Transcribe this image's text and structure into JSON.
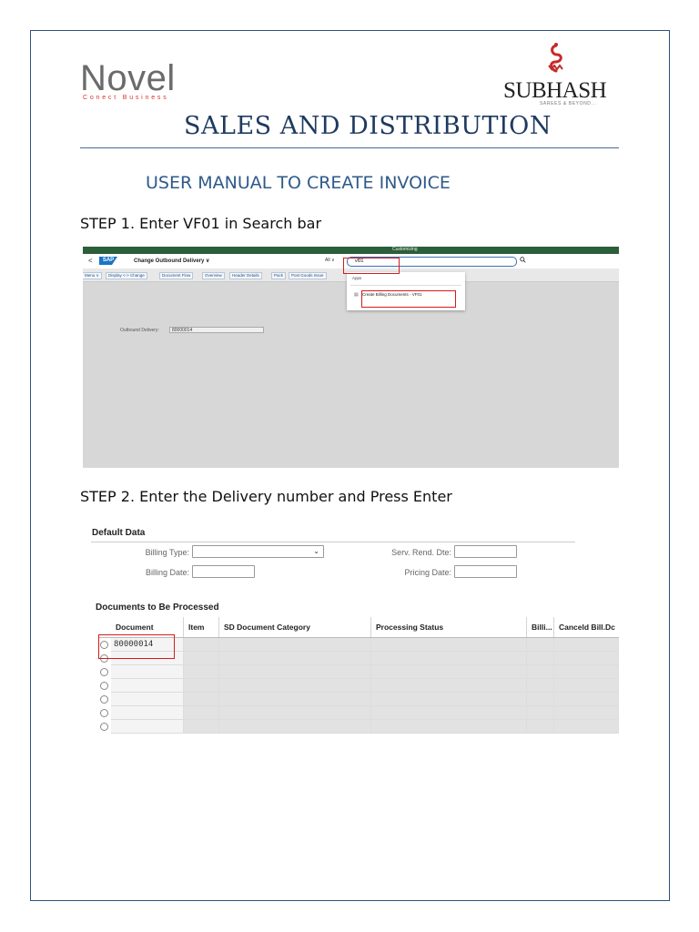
{
  "header": {
    "left_logo": "Novel",
    "left_logo_tagline": "Conect Business",
    "right_logo": "SUBHASH",
    "right_logo_tagline": "SAREES & BEYOND...",
    "title": "SALES AND DISTRIBUTION",
    "subtitle": "USER MANUAL TO CREATE INVOICE"
  },
  "steps": [
    {
      "label": "STEP 1. Enter VF01 in Search bar"
    },
    {
      "label": "STEP 2. Enter the Delivery number and Press Enter"
    }
  ],
  "screenshot1": {
    "top_bar_text": "Customizing",
    "back_glyph": "<",
    "sap_logo": "SAP",
    "app_title": "Change Outbound Delivery ∨",
    "search_scope": "All ∨",
    "search_value": "vf01",
    "toolbar": [
      "Menu ∨",
      "Display <-> Change",
      "Document Flow",
      "Overview",
      "Header Details",
      "Pack",
      "Post Goods Issue"
    ],
    "dropdown_header": "Apps",
    "dropdown_item": "Create Billing Documents - VF01",
    "field_label": "Outbound Delivery:",
    "field_value": "80000014",
    "colors": {
      "top_bar": "#2b5e3a",
      "highlight": "#d31c1c",
      "sap_blue": "#1a73c7"
    }
  },
  "screenshot2": {
    "section_title": "Default Data",
    "fields": [
      {
        "label": "Billing Type:",
        "value": ""
      },
      {
        "label": "Billing Date:",
        "value": ""
      },
      {
        "label": "Serv. Rend. Dte:",
        "value": ""
      },
      {
        "label": "Pricing Date:",
        "value": ""
      }
    ],
    "table_title": "Documents to Be Processed",
    "columns": [
      "Document",
      "Item",
      "SD Document Category",
      "Processing Status",
      "Billi...",
      "Canceld Bill.Dc"
    ],
    "rows": [
      {
        "document": "80000014",
        "selected": false
      },
      {
        "document": "",
        "selected": false
      },
      {
        "document": "",
        "selected": false
      },
      {
        "document": "",
        "selected": false
      },
      {
        "document": "",
        "selected": false
      },
      {
        "document": "",
        "selected": false
      },
      {
        "document": "",
        "selected": false
      }
    ]
  }
}
